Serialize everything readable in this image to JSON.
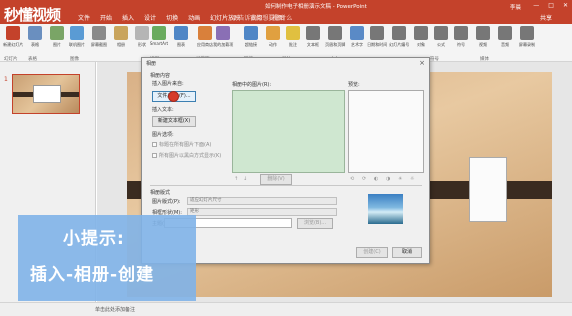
{
  "app": {
    "logo_text": "秒懂视频",
    "doc_title": "如何制作电子相册演示文稿 - PowerPoint",
    "user": "李晨",
    "share": "共享",
    "search_hint": "告诉我你想要做什么",
    "tabs": [
      "文件",
      "开始",
      "插入",
      "设计",
      "切换",
      "动画",
      "幻灯片放映",
      "审阅",
      "视图"
    ]
  },
  "ribbon": {
    "buttons": [
      {
        "label": "新建幻灯片",
        "color": "#c4422b"
      },
      {
        "label": "表格",
        "color": "#6a8fbf"
      },
      {
        "label": "图片",
        "color": "#7aa566"
      },
      {
        "label": "联机图片",
        "color": "#5a9bd4"
      },
      {
        "label": "屏幕截图",
        "color": "#8a8a8a"
      },
      {
        "label": "相册",
        "color": "#c9a45c"
      },
      {
        "label": "形状",
        "color": "#b5b5b5"
      },
      {
        "label": "SmartArt",
        "color": "#6aab5e"
      },
      {
        "label": "图表",
        "color": "#4f86c6"
      },
      {
        "label": "应用商店",
        "color": "#d9803b"
      },
      {
        "label": "我的加载项",
        "color": "#8a6fb5"
      },
      {
        "label": "超链接",
        "color": "#4f86c6"
      },
      {
        "label": "动作",
        "color": "#e0a040"
      },
      {
        "label": "批注",
        "color": "#e0c040"
      },
      {
        "label": "文本框",
        "color": "#777777"
      },
      {
        "label": "页眉和页脚",
        "color": "#777777"
      },
      {
        "label": "艺术字",
        "color": "#5a8ac6"
      },
      {
        "label": "日期和时间",
        "color": "#777777"
      },
      {
        "label": "幻灯片编号",
        "color": "#777777"
      },
      {
        "label": "对象",
        "color": "#777777"
      },
      {
        "label": "公式",
        "color": "#777777"
      },
      {
        "label": "符号",
        "color": "#777777"
      },
      {
        "label": "视频",
        "color": "#777777"
      },
      {
        "label": "音频",
        "color": "#777777"
      },
      {
        "label": "屏幕录制",
        "color": "#777777"
      }
    ],
    "groups": [
      "幻灯片",
      "表格",
      "图像",
      "插图",
      "加载项",
      "链接",
      "批注",
      "文本",
      "符号",
      "媒体"
    ]
  },
  "slide_panel": {
    "slide_number": "1"
  },
  "status": {
    "notes_hint": "单击此处添加备注"
  },
  "dialog": {
    "title": "相册",
    "close": "×",
    "album_content": "相册内容",
    "insert_picture_from": "插入图片来自:",
    "file_disk_button": "文件/磁盘(F)...",
    "insert_text": "插入文本:",
    "new_textbox_button": "新建文本框(X)",
    "picture_options": "图片选项:",
    "caption_below": "标题在所有图片下面(A)",
    "all_bw": "所有图片以黑白方式显示(K)",
    "pictures_in_album": "相册中的图片(R):",
    "preview": "预览:",
    "remove_button": "删除(V)",
    "album_layout": "相册版式",
    "picture_layout": "图片版式(P):",
    "picture_layout_value": "适应幻灯片尺寸",
    "frame_shape": "相框形状(M):",
    "frame_shape_value": "矩形",
    "theme": "主题(T):",
    "browse_button": "浏览(B)...",
    "create_button": "创建(C)",
    "cancel_button": "取消"
  },
  "tip": {
    "title": "小提示:",
    "body": "插入-相册-创建"
  }
}
